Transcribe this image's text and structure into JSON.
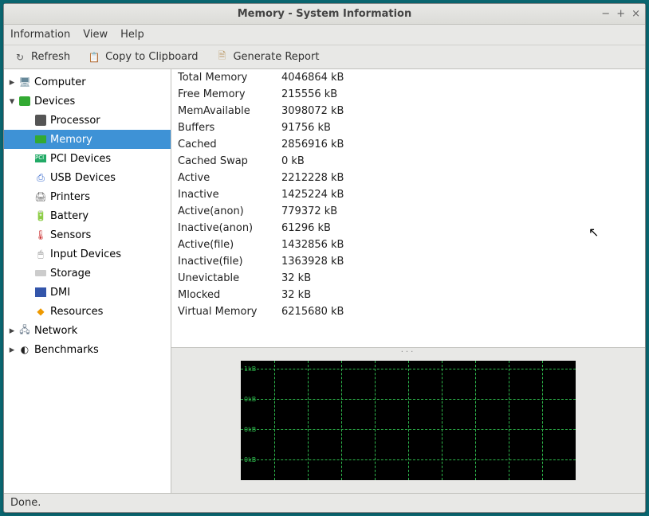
{
  "window": {
    "title": "Memory - System Information"
  },
  "menubar": {
    "items": [
      "Information",
      "View",
      "Help"
    ]
  },
  "toolbar": {
    "refresh": "Refresh",
    "clipboard": "Copy to Clipboard",
    "report": "Generate Report"
  },
  "sidebar": {
    "nodes": [
      {
        "label": "Computer",
        "expandable": true,
        "expanded": false,
        "icon": "computer-icon"
      },
      {
        "label": "Devices",
        "expandable": true,
        "expanded": true,
        "icon": "devices-icon",
        "children": [
          {
            "label": "Processor",
            "icon": "processor-icon"
          },
          {
            "label": "Memory",
            "icon": "memory-icon",
            "selected": true
          },
          {
            "label": "PCI Devices",
            "icon": "pci-icon"
          },
          {
            "label": "USB Devices",
            "icon": "usb-icon"
          },
          {
            "label": "Printers",
            "icon": "printer-icon"
          },
          {
            "label": "Battery",
            "icon": "battery-icon"
          },
          {
            "label": "Sensors",
            "icon": "sensors-icon"
          },
          {
            "label": "Input Devices",
            "icon": "input-icon"
          },
          {
            "label": "Storage",
            "icon": "storage-icon"
          },
          {
            "label": "DMI",
            "icon": "dmi-icon"
          },
          {
            "label": "Resources",
            "icon": "resources-icon"
          }
        ]
      },
      {
        "label": "Network",
        "expandable": true,
        "expanded": false,
        "icon": "network-icon"
      },
      {
        "label": "Benchmarks",
        "expandable": true,
        "expanded": false,
        "icon": "benchmarks-icon"
      }
    ]
  },
  "memory_rows": [
    {
      "label": "Total Memory",
      "value": "4046864 kB"
    },
    {
      "label": "Free Memory",
      "value": "215556 kB"
    },
    {
      "label": "MemAvailable",
      "value": "3098072 kB"
    },
    {
      "label": "Buffers",
      "value": "91756 kB"
    },
    {
      "label": "Cached",
      "value": "2856916 kB"
    },
    {
      "label": "Cached Swap",
      "value": "0 kB"
    },
    {
      "label": "Active",
      "value": "2212228 kB"
    },
    {
      "label": "Inactive",
      "value": "1425224 kB"
    },
    {
      "label": "Active(anon)",
      "value": "779372 kB"
    },
    {
      "label": "Inactive(anon)",
      "value": "61296 kB"
    },
    {
      "label": "Active(file)",
      "value": "1432856 kB"
    },
    {
      "label": "Inactive(file)",
      "value": "1363928 kB"
    },
    {
      "label": "Unevictable",
      "value": "32 kB"
    },
    {
      "label": "Mlocked",
      "value": "32 kB"
    },
    {
      "label": "Virtual Memory",
      "value": "6215680 kB"
    }
  ],
  "chart_data": {
    "type": "line",
    "title": "",
    "xlabel": "",
    "ylabel": "",
    "ytick_labels": [
      "1kB",
      "0kB",
      "0kB",
      "0kB"
    ],
    "series": [],
    "grid": true
  },
  "statusbar": {
    "text": "Done."
  }
}
